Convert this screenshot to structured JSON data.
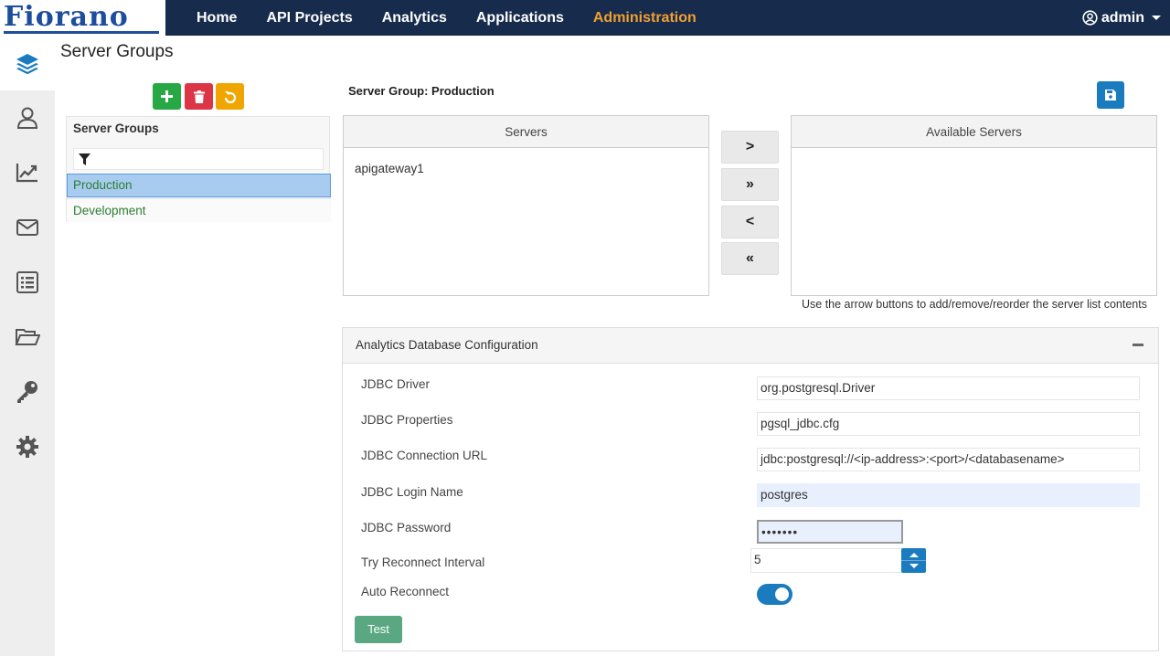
{
  "brand": {
    "logo_text": "Fiorano"
  },
  "nav": {
    "items": [
      {
        "label": "Home"
      },
      {
        "label": "API Projects"
      },
      {
        "label": "Analytics"
      },
      {
        "label": "Applications"
      },
      {
        "label": "Administration",
        "active": true
      }
    ],
    "active_color": "#f0a030"
  },
  "user": {
    "name": "admin"
  },
  "sidebar": {
    "icons": [
      "layers-icon",
      "user-icon",
      "chart-icon",
      "mail-icon",
      "list-icon",
      "folder-open-icon",
      "key-icon",
      "gear-icon"
    ]
  },
  "page": {
    "title": "Server Groups"
  },
  "server_groups": {
    "title": "Server Groups",
    "filter_placeholder": "",
    "items": [
      {
        "label": "Production",
        "selected": true
      },
      {
        "label": "Development",
        "selected": false
      }
    ]
  },
  "detail": {
    "group_label": "Server Group: Production",
    "servers_header": "Servers",
    "servers": [
      "apigateway1"
    ],
    "available_header": "Available Servers",
    "available": [],
    "arrows": [
      ">",
      "»",
      "<",
      "«"
    ],
    "hint": "Use the arrow buttons to add/remove/reorder the server list contents"
  },
  "db_config": {
    "title": "Analytics Database Configuration",
    "jdbc_driver_label": "JDBC Driver",
    "jdbc_driver": "org.postgresql.Driver",
    "jdbc_properties_label": "JDBC Properties",
    "jdbc_properties": "pgsql_jdbc.cfg",
    "jdbc_url_label": "JDBC Connection URL",
    "jdbc_url": "jdbc:postgresql://<ip-address>:<port>/<databasename>",
    "jdbc_login_label": "JDBC Login Name",
    "jdbc_login": "postgres",
    "jdbc_password_label": "JDBC Password",
    "jdbc_password": "•••••••",
    "reconnect_interval_label": "Try Reconnect Interval",
    "reconnect_interval": "5",
    "auto_reconnect_label": "Auto Reconnect",
    "auto_reconnect": true,
    "test_label": "Test"
  },
  "colors": {
    "topbar": "#172b4d",
    "add": "#28a745",
    "delete": "#dc3545",
    "refresh": "#f0a500",
    "primary": "#1a7bbf",
    "test": "#5aa882"
  }
}
